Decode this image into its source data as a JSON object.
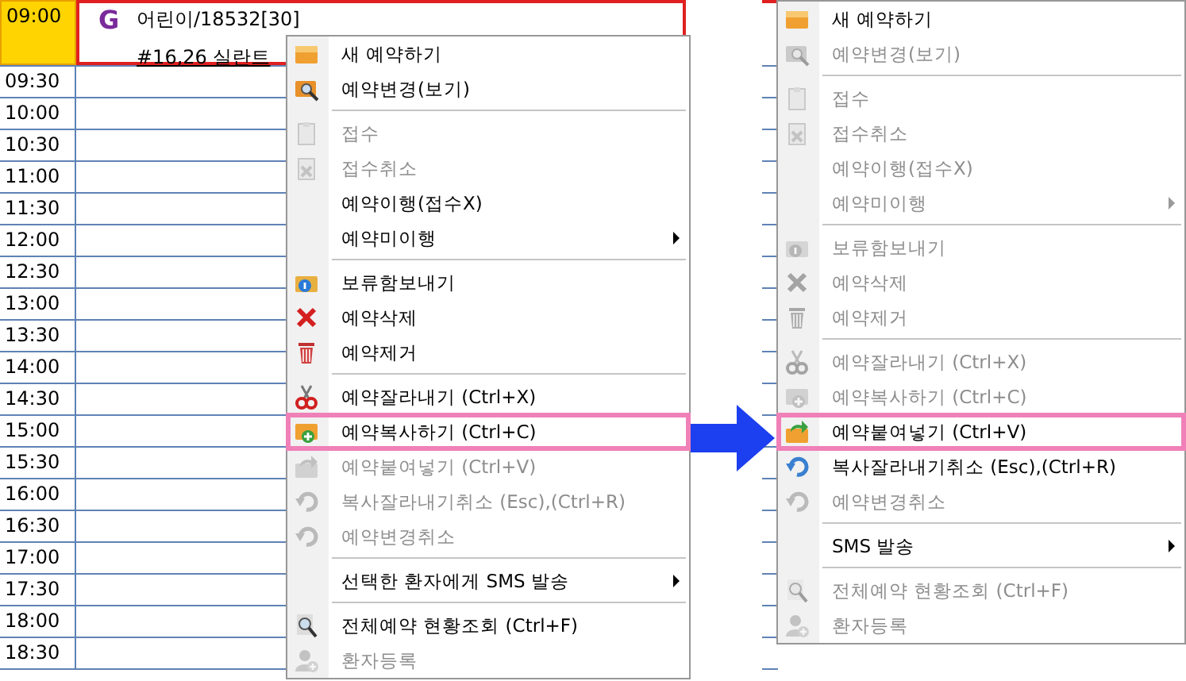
{
  "schedule": {
    "slots": [
      {
        "time": "09:00",
        "selected": true
      },
      {
        "time": "09:30",
        "selected": false
      },
      {
        "time": "10:00",
        "selected": false
      },
      {
        "time": "10:30",
        "selected": false
      },
      {
        "time": "11:00",
        "selected": false
      },
      {
        "time": "11:30",
        "selected": false
      },
      {
        "time": "12:00",
        "selected": false
      },
      {
        "time": "12:30",
        "selected": false
      },
      {
        "time": "13:00",
        "selected": false
      },
      {
        "time": "13:30",
        "selected": false
      },
      {
        "time": "14:00",
        "selected": false
      },
      {
        "time": "14:30",
        "selected": false
      },
      {
        "time": "15:00",
        "selected": false
      },
      {
        "time": "15:30",
        "selected": false
      },
      {
        "time": "16:00",
        "selected": false
      },
      {
        "time": "16:30",
        "selected": false
      },
      {
        "time": "17:00",
        "selected": false
      },
      {
        "time": "17:30",
        "selected": false
      },
      {
        "time": "18:00",
        "selected": false
      },
      {
        "time": "18:30",
        "selected": false
      }
    ],
    "appointment": {
      "badge": "G",
      "title": "어린이/18532[30]",
      "note": "#16,26 실란트"
    }
  },
  "menus": [
    {
      "items": [
        {
          "kind": "item",
          "label": "새 예약하기",
          "disabled": false,
          "submenu": false,
          "selected": false
        },
        {
          "kind": "item",
          "label": "예약변경(보기)",
          "disabled": false,
          "submenu": false,
          "selected": false
        },
        {
          "kind": "separator"
        },
        {
          "kind": "item",
          "label": "접수",
          "disabled": true,
          "submenu": false,
          "selected": false
        },
        {
          "kind": "item",
          "label": "접수취소",
          "disabled": true,
          "submenu": false,
          "selected": false
        },
        {
          "kind": "item",
          "label": "예약이행(접수X)",
          "disabled": false,
          "submenu": false,
          "selected": false
        },
        {
          "kind": "item",
          "label": "예약미이행",
          "disabled": false,
          "submenu": true,
          "selected": false
        },
        {
          "kind": "separator"
        },
        {
          "kind": "item",
          "label": "보류함보내기",
          "disabled": false,
          "submenu": false,
          "selected": false
        },
        {
          "kind": "item",
          "label": "예약삭제",
          "disabled": false,
          "submenu": false,
          "selected": false
        },
        {
          "kind": "item",
          "label": "예약제거",
          "disabled": false,
          "submenu": false,
          "selected": false
        },
        {
          "kind": "separator"
        },
        {
          "kind": "item",
          "label": "예약잘라내기 (Ctrl+X)",
          "disabled": false,
          "submenu": false,
          "selected": false
        },
        {
          "kind": "item",
          "label": "예약복사하기 (Ctrl+C)",
          "disabled": false,
          "submenu": false,
          "selected": true
        },
        {
          "kind": "item",
          "label": "예약붙여넣기 (Ctrl+V)",
          "disabled": true,
          "submenu": false,
          "selected": false
        },
        {
          "kind": "item",
          "label": "복사잘라내기취소 (Esc),(Ctrl+R)",
          "disabled": true,
          "submenu": false,
          "selected": false
        },
        {
          "kind": "item",
          "label": "예약변경취소",
          "disabled": true,
          "submenu": false,
          "selected": false
        },
        {
          "kind": "separator"
        },
        {
          "kind": "item",
          "label": "선택한 환자에게 SMS 발송",
          "disabled": false,
          "submenu": true,
          "selected": false
        },
        {
          "kind": "separator"
        },
        {
          "kind": "item",
          "label": "전체예약 현황조회 (Ctrl+F)",
          "disabled": false,
          "submenu": false,
          "selected": false
        },
        {
          "kind": "item",
          "label": "환자등록",
          "disabled": true,
          "submenu": false,
          "selected": false
        }
      ]
    },
    {
      "items": [
        {
          "kind": "item",
          "label": "새 예약하기",
          "disabled": false,
          "submenu": false,
          "selected": false
        },
        {
          "kind": "item",
          "label": "예약변경(보기)",
          "disabled": true,
          "submenu": false,
          "selected": false
        },
        {
          "kind": "separator"
        },
        {
          "kind": "item",
          "label": "접수",
          "disabled": true,
          "submenu": false,
          "selected": false
        },
        {
          "kind": "item",
          "label": "접수취소",
          "disabled": true,
          "submenu": false,
          "selected": false
        },
        {
          "kind": "item",
          "label": "예약이행(접수X)",
          "disabled": true,
          "submenu": false,
          "selected": false
        },
        {
          "kind": "item",
          "label": "예약미이행",
          "disabled": true,
          "submenu": true,
          "selected": false
        },
        {
          "kind": "separator"
        },
        {
          "kind": "item",
          "label": "보류함보내기",
          "disabled": true,
          "submenu": false,
          "selected": false
        },
        {
          "kind": "item",
          "label": "예약삭제",
          "disabled": true,
          "submenu": false,
          "selected": false
        },
        {
          "kind": "item",
          "label": "예약제거",
          "disabled": true,
          "submenu": false,
          "selected": false
        },
        {
          "kind": "separator"
        },
        {
          "kind": "item",
          "label": "예약잘라내기 (Ctrl+X)",
          "disabled": true,
          "submenu": false,
          "selected": false
        },
        {
          "kind": "item",
          "label": "예약복사하기 (Ctrl+C)",
          "disabled": true,
          "submenu": false,
          "selected": false
        },
        {
          "kind": "item",
          "label": "예약붙여넣기 (Ctrl+V)",
          "disabled": false,
          "submenu": false,
          "selected": true
        },
        {
          "kind": "item",
          "label": "복사잘라내기취소 (Esc),(Ctrl+R)",
          "disabled": false,
          "submenu": false,
          "selected": false
        },
        {
          "kind": "item",
          "label": "예약변경취소",
          "disabled": true,
          "submenu": false,
          "selected": false
        },
        {
          "kind": "separator"
        },
        {
          "kind": "item",
          "label": "SMS 발송",
          "disabled": false,
          "submenu": true,
          "selected": false
        },
        {
          "kind": "separator"
        },
        {
          "kind": "item",
          "label": "전체예약 현황조회 (Ctrl+F)",
          "disabled": true,
          "submenu": false,
          "selected": false
        },
        {
          "kind": "item",
          "label": "환자등록",
          "disabled": true,
          "submenu": false,
          "selected": false
        }
      ]
    }
  ]
}
